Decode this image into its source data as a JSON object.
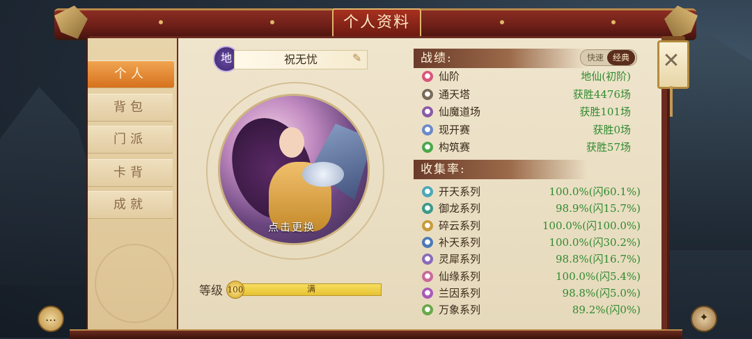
{
  "window": {
    "title": "个人资料"
  },
  "sidebar": {
    "tabs": [
      {
        "label": "个人",
        "active": true
      },
      {
        "label": "背包",
        "active": false
      },
      {
        "label": "门派",
        "active": false
      },
      {
        "label": "卡背",
        "active": false
      },
      {
        "label": "成就",
        "active": false
      }
    ]
  },
  "profile": {
    "rank_badge": "地",
    "name": "祝无忧",
    "avatar_change_label": "点击更换",
    "level_label": "等级",
    "level_value": "100",
    "level_bar_text": "满",
    "level_progress": 1.0
  },
  "record": {
    "header": "战绩:",
    "mode_toggle": {
      "options": [
        "快速",
        "经典"
      ],
      "selected": "经典"
    },
    "rows": [
      {
        "icon": "star-icon",
        "color": "#d9567a",
        "label": "仙阶",
        "value": "地仙(初阶)"
      },
      {
        "icon": "tower-icon",
        "color": "#7a6a58",
        "label": "通天塔",
        "value": "获胜4476场"
      },
      {
        "icon": "demon-icon",
        "color": "#8a5aa8",
        "label": "仙魔道场",
        "value": "获胜101场"
      },
      {
        "icon": "open-match-icon",
        "color": "#6a8ac8",
        "label": "现开赛",
        "value": "获胜0场"
      },
      {
        "icon": "build-icon",
        "color": "#4aa84a",
        "label": "构筑赛",
        "value": "获胜57场"
      }
    ]
  },
  "collection": {
    "header": "收集率:",
    "rows": [
      {
        "icon": "kaitian-icon",
        "color": "#4aa8b8",
        "label": "开天系列",
        "value": "100.0%(闪60.1%)"
      },
      {
        "icon": "yulong-icon",
        "color": "#3a9a8a",
        "label": "御龙系列",
        "value": "98.9%(闪15.7%)"
      },
      {
        "icon": "suiyun-icon",
        "color": "#c89a3a",
        "label": "碎云系列",
        "value": "100.0%(闪100.0%)"
      },
      {
        "icon": "butian-icon",
        "color": "#4a7ab8",
        "label": "补天系列",
        "value": "100.0%(闪30.2%)"
      },
      {
        "icon": "lingxi-icon",
        "color": "#8a6ab8",
        "label": "灵犀系列",
        "value": "98.8%(闪16.7%)"
      },
      {
        "icon": "xianyuan-icon",
        "color": "#c86a9a",
        "label": "仙缘系列",
        "value": "100.0%(闪5.4%)"
      },
      {
        "icon": "lanyin-icon",
        "color": "#a85ab8",
        "label": "兰因系列",
        "value": "98.8%(闪5.0%)"
      },
      {
        "icon": "wanxiang-icon",
        "color": "#6aa84a",
        "label": "万象系列",
        "value": "89.2%(闪0%)"
      }
    ]
  },
  "accent_colors": {
    "active_tab": "#e08a30",
    "value_green": "#2f8a2f",
    "beam_red": "#7a2318"
  }
}
